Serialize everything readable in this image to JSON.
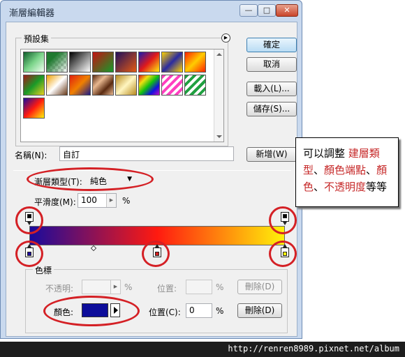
{
  "window": {
    "title": "漸層編輯器",
    "minimize_symbol": "—",
    "maximize_symbol": "□",
    "close_symbol": "✕"
  },
  "presets": {
    "label": "預設集",
    "menu_icon": "triangle-right-icon"
  },
  "buttons": {
    "ok": "確定",
    "cancel": "取消",
    "load": "載入(L)...",
    "save": "儲存(S)...",
    "new": "新增(W)",
    "delete": "刪除(D)"
  },
  "name": {
    "label": "名稱(N):",
    "value": "自訂"
  },
  "gradient_type": {
    "label": "漸層類型(T):",
    "value": "純色"
  },
  "smoothness": {
    "label": "平滑度(M):",
    "value": "100",
    "unit": "%"
  },
  "color_stops": {
    "label": "色標",
    "opacity_label": "不透明:",
    "opacity_unit": "%",
    "opacity_location_label": "位置:",
    "opacity_location_unit": "%",
    "color_label": "顏色:",
    "color_value": "#0d0d9a",
    "color_location_label": "位置(C):",
    "color_location_value": "0",
    "color_location_unit": "%"
  },
  "annotation": {
    "part1": "可以調整",
    "part2": "建層類型",
    "part3": "、",
    "part4": "顏色端點",
    "part5": "、",
    "part6": "顏色",
    "part7": "、",
    "part8": "不透明度",
    "part9": "等等"
  },
  "watermark": "http://renren8989.pixnet.net/album",
  "colors": {
    "gradient_start": "#1a0a9c",
    "gradient_mid": "#ff1a10",
    "gradient_end": "#fff20a",
    "selected_color": "#0d0d9a",
    "annotation_red": "#d42025"
  }
}
